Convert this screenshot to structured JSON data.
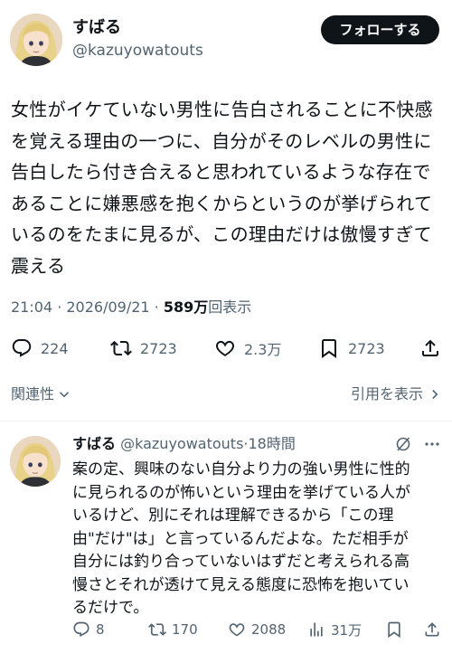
{
  "tweet": {
    "display_name": "すばる",
    "handle": "@kazuyowatouts",
    "follow_label": "フォローする",
    "text": "女性がイケていない男性に告白されることに不快感\nを覚える理由の一つに、自分がそのレベルの男性に\n告白したら付き合えると思われているような存在で\nあることに嫌悪感を抱くからというのが挙げられて\nいるのをたまに見るが、この理由だけは傲慢すぎて\n震える",
    "time": "21:04",
    "separator": " · ",
    "date": "2026/09/21",
    "views_count": "589万",
    "views_label": "回表示",
    "actions": {
      "reply_count": "224",
      "retweet_count": "2723",
      "like_count": "2.3万",
      "bookmark_count": "2723"
    },
    "sort_label": "関連性",
    "quote_label": "引用を表示"
  },
  "reply": {
    "display_name": "すばる",
    "handle": "@kazuyowatouts",
    "separator": "·",
    "time_ago": "18時間",
    "text": "案の定、興味のない自分より力の強い男性に性的\nに見られるのが怖いという理由を挙げている人が\nいるけど、別にそれは理解できるから「この理\n由\"だけ\"は」と言っているんだよな。ただ相手が\n自分には釣り合っていないはずだと考えられる高\n慢さとそれが透けて見える態度に恐怖を抱いてい\nるだけで。",
    "actions": {
      "reply_count": "8",
      "retweet_count": "170",
      "like_count": "2088",
      "views_count": "31万"
    }
  },
  "colors": {
    "text_primary": "#0f1419",
    "text_secondary": "#536471",
    "follow_button_bg": "#0f1419",
    "divider": "#eff3f4"
  },
  "icons": [
    "reply-icon",
    "retweet-icon",
    "like-icon",
    "bookmark-icon",
    "share-icon",
    "chevron-down-icon",
    "chevron-right-icon",
    "grok-icon",
    "analytics-icon"
  ]
}
